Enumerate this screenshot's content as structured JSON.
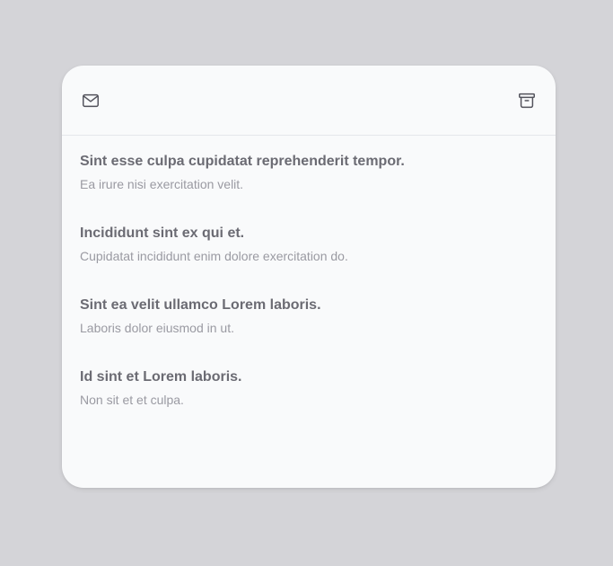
{
  "card": {
    "header": {
      "left_icon": "mail-icon",
      "right_icon": "archive-icon"
    },
    "items": [
      {
        "title": "Sint esse culpa cupidatat reprehenderit tempor.",
        "subtitle": "Ea irure nisi exercitation velit."
      },
      {
        "title": "Incididunt sint ex qui et.",
        "subtitle": "Cupidatat incididunt enim dolore exercitation do."
      },
      {
        "title": "Sint ea velit ullamco Lorem laboris.",
        "subtitle": "Laboris dolor eiusmod in ut."
      },
      {
        "title": "Id sint et Lorem laboris.",
        "subtitle": "Non sit et et culpa."
      }
    ]
  },
  "colors": {
    "background": "#d4d4d8",
    "card": "#f9fafb",
    "divider": "#e5e7eb",
    "title": "#6b6b73",
    "subtitle": "#9a9aa2",
    "icon": "#52525b"
  }
}
